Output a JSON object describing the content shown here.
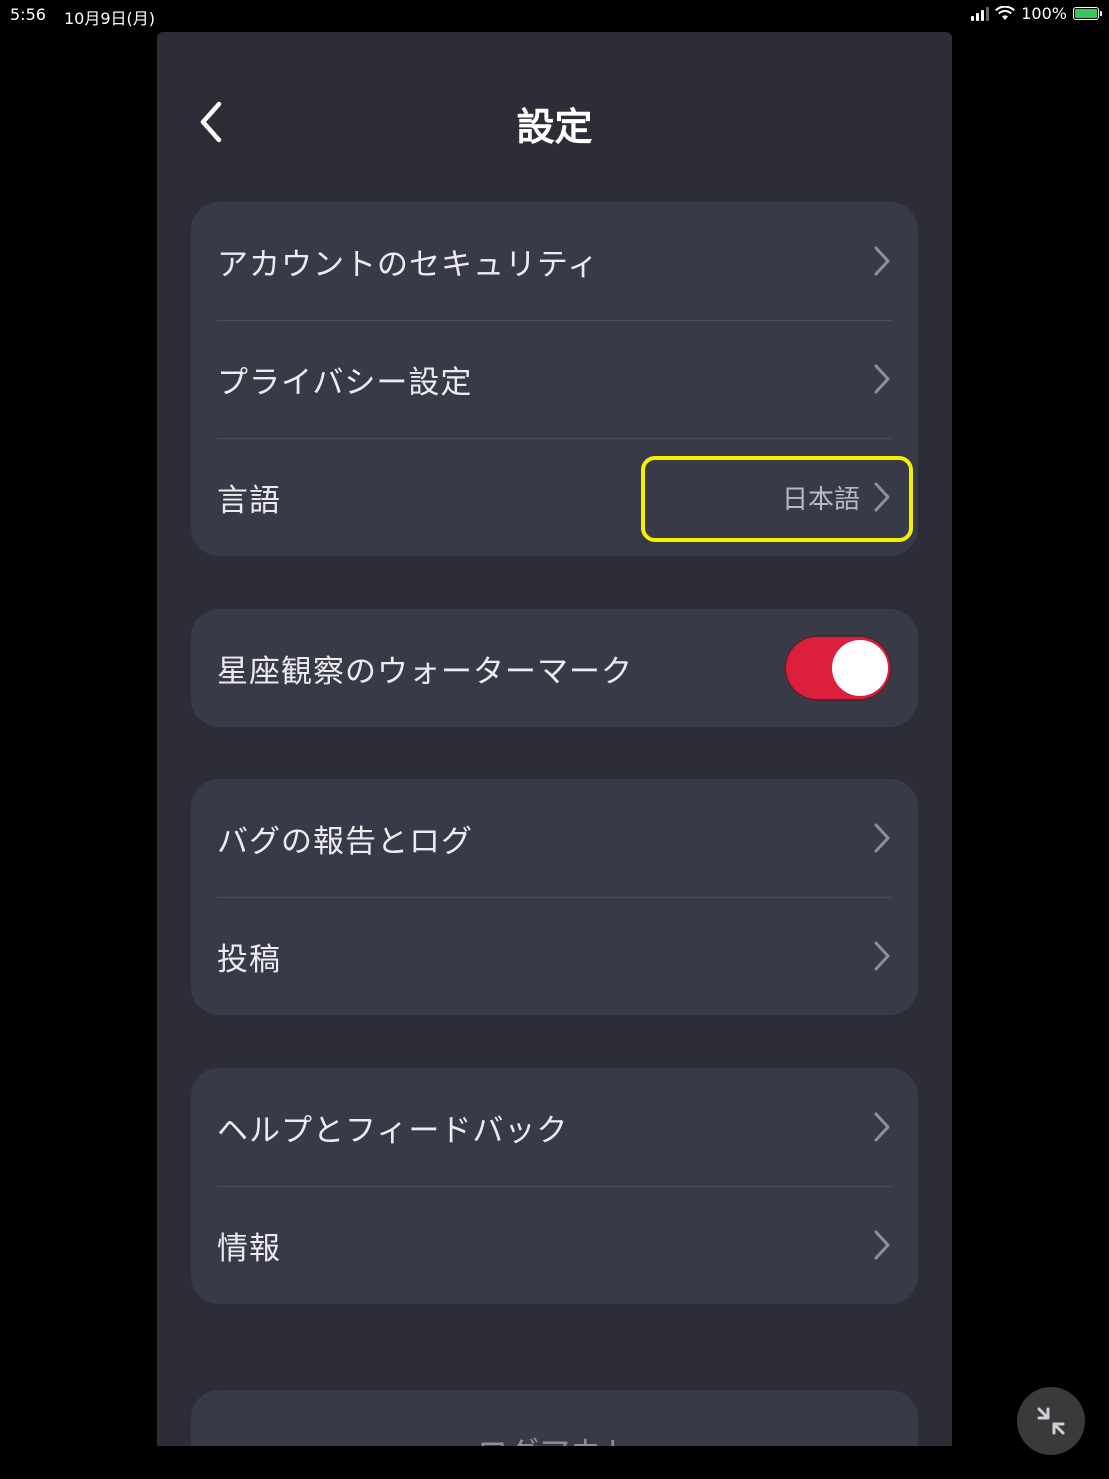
{
  "status_bar": {
    "time": "5:56",
    "date": "10月9日(月)",
    "battery": "100%"
  },
  "header": {
    "title": "設定"
  },
  "groups": [
    {
      "items": [
        {
          "label": "アカウントのセキュリティ",
          "value": ""
        },
        {
          "label": "プライバシー設定",
          "value": ""
        },
        {
          "label": "言語",
          "value": "日本語"
        }
      ]
    },
    {
      "items": [
        {
          "label": "星座観察のウォーターマーク",
          "toggle": true
        }
      ]
    },
    {
      "items": [
        {
          "label": "バグの報告とログ",
          "value": ""
        },
        {
          "label": "投稿",
          "value": ""
        }
      ]
    },
    {
      "items": [
        {
          "label": "ヘルプとフィードバック",
          "value": ""
        },
        {
          "label": "情報",
          "value": ""
        }
      ]
    }
  ],
  "logout": {
    "label": "ログアウト"
  },
  "colors": {
    "panel_bg": "#2c2d37",
    "group_bg": "#393a47",
    "toggle_on": "#dc1f3d",
    "highlight": "#f4f000"
  },
  "icons": {
    "back": "chevron-left-icon",
    "row_arrow": "chevron-right-icon",
    "collapse": "collapse-arrows-icon"
  }
}
